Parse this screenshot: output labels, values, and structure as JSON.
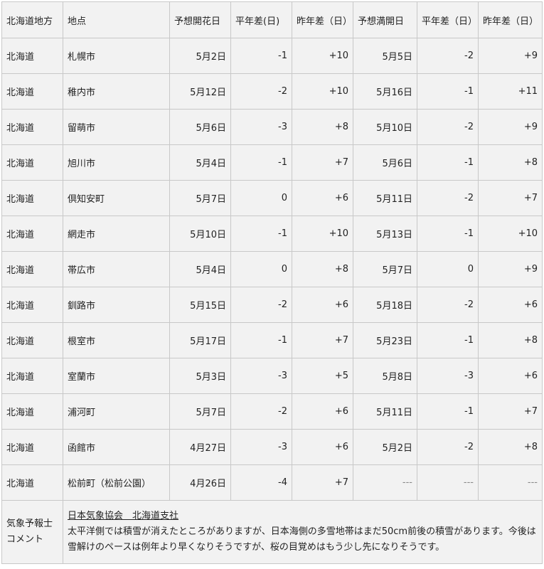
{
  "headers": [
    "北海道地方",
    "地点",
    "予想開花日",
    "平年差(日)",
    "昨年差（日）",
    "予想満開日",
    "平年差（日）",
    "昨年差（日）"
  ],
  "rows": [
    [
      "北海道",
      "札幌市",
      "5月2日",
      "-1",
      "+10",
      "5月5日",
      "-2",
      "+9"
    ],
    [
      "北海道",
      "稚内市",
      "5月12日",
      "-2",
      "+10",
      "5月16日",
      "-1",
      "+11"
    ],
    [
      "北海道",
      "留萌市",
      "5月6日",
      "-3",
      "+8",
      "5月10日",
      "-2",
      "+9"
    ],
    [
      "北海道",
      "旭川市",
      "5月4日",
      "-1",
      "+7",
      "5月6日",
      "-1",
      "+8"
    ],
    [
      "北海道",
      "倶知安町",
      "5月7日",
      "0",
      "+6",
      "5月11日",
      "-2",
      "+7"
    ],
    [
      "北海道",
      "網走市",
      "5月10日",
      "-1",
      "+10",
      "5月13日",
      "-1",
      "+10"
    ],
    [
      "北海道",
      "帯広市",
      "5月4日",
      "0",
      "+8",
      "5月7日",
      "0",
      "+9"
    ],
    [
      "北海道",
      "釧路市",
      "5月15日",
      "-2",
      "+6",
      "5月18日",
      "-2",
      "+6"
    ],
    [
      "北海道",
      "根室市",
      "5月17日",
      "-1",
      "+7",
      "5月23日",
      "-1",
      "+8"
    ],
    [
      "北海道",
      "室蘭市",
      "5月3日",
      "-3",
      "+5",
      "5月8日",
      "-3",
      "+6"
    ],
    [
      "北海道",
      "浦河町",
      "5月7日",
      "-2",
      "+6",
      "5月11日",
      "-1",
      "+7"
    ],
    [
      "北海道",
      "函館市",
      "4月27日",
      "-3",
      "+6",
      "5月2日",
      "-2",
      "+8"
    ],
    [
      "北海道",
      "松前町（松前公園）",
      "4月26日",
      "-4",
      "+7",
      "---",
      "---",
      "---"
    ]
  ],
  "comment": {
    "label": "気象予報士コメント",
    "organization": "日本気象協会　北海道支社",
    "text": "太平洋側では積雪が消えたところがありますが、日本海側の多雪地帯はまだ50cm前後の積雪があります。今後は雪解けのペースは例年より早くなりそうですが、桜の目覚めはもう少し先になりそうです。"
  },
  "colors": {
    "cell_background": "#f2f2f2",
    "border": "#c8c8c8",
    "text": "#222222"
  }
}
